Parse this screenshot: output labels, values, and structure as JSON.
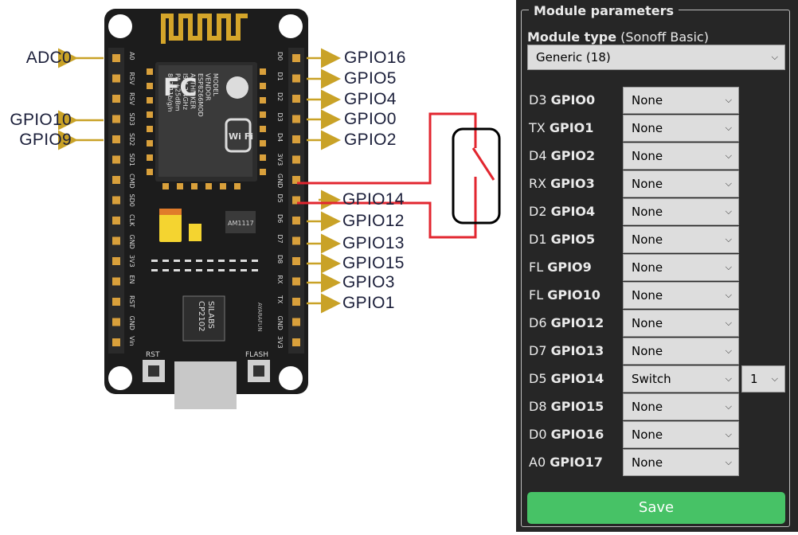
{
  "board": {
    "left_pins": [
      "ADC0",
      "GPIO10",
      "GPIO9"
    ],
    "right_pins": [
      "GPIO16",
      "GPIO5",
      "GPIO4",
      "GPIO0",
      "GPIO2",
      "GPIO14",
      "GPIO12",
      "GPIO13",
      "GPIO15",
      "GPIO3",
      "GPIO1"
    ],
    "silk_left": [
      "A0",
      "RSV",
      "RSV",
      "SD3",
      "SD2",
      "SD1",
      "CMD",
      "SD0",
      "CLK",
      "GND",
      "3V3",
      "EN",
      "RST",
      "GND",
      "Vin"
    ],
    "silk_right": [
      "D0",
      "D1",
      "D2",
      "D3",
      "D4",
      "3V3",
      "GND",
      "D5",
      "D6",
      "D7",
      "D8",
      "RX",
      "TX",
      "GND",
      "3V3"
    ],
    "module_text": [
      "MODEL",
      "VENDOR",
      "ESP8266MOD",
      "AI-THINKER",
      "ISM 2.4GHz",
      "PA +25dBm",
      "802.11b/g/n"
    ],
    "fc_logo": "FC",
    "wifi_logo": "Wi Fi",
    "regulator": "AM1117",
    "chip_text": [
      "SILABS",
      "CP2102"
    ],
    "rst_label": "RST",
    "flash_label": "FLASH",
    "brand": "AYARAFUN"
  },
  "panel": {
    "legend": "Module parameters",
    "module_type_label": "Module type",
    "module_type_hint": "(Sonoff Basic)",
    "module_type_value": "Generic (18)",
    "rows": [
      {
        "prefix": "D3",
        "gpio": "GPIO0",
        "value": "None"
      },
      {
        "prefix": "TX",
        "gpio": "GPIO1",
        "value": "None"
      },
      {
        "prefix": "D4",
        "gpio": "GPIO2",
        "value": "None"
      },
      {
        "prefix": "RX",
        "gpio": "GPIO3",
        "value": "None"
      },
      {
        "prefix": "D2",
        "gpio": "GPIO4",
        "value": "None"
      },
      {
        "prefix": "D1",
        "gpio": "GPIO5",
        "value": "None"
      },
      {
        "prefix": "FL",
        "gpio": "GPIO9",
        "value": "None"
      },
      {
        "prefix": "FL",
        "gpio": "GPIO10",
        "value": "None"
      },
      {
        "prefix": "D6",
        "gpio": "GPIO12",
        "value": "None"
      },
      {
        "prefix": "D7",
        "gpio": "GPIO13",
        "value": "None"
      },
      {
        "prefix": "D5",
        "gpio": "GPIO14",
        "value": "Switch",
        "index": "1"
      },
      {
        "prefix": "D8",
        "gpio": "GPIO15",
        "value": "None"
      },
      {
        "prefix": "D0",
        "gpio": "GPIO16",
        "value": "None"
      },
      {
        "prefix": "A0",
        "gpio": "GPIO17",
        "value": "None"
      }
    ],
    "save_label": "Save"
  },
  "colors": {
    "arrow": "#c9a227",
    "wire": "#e2262f",
    "board": "#1c1c1c",
    "save": "#47c266",
    "panel": "#262626"
  }
}
